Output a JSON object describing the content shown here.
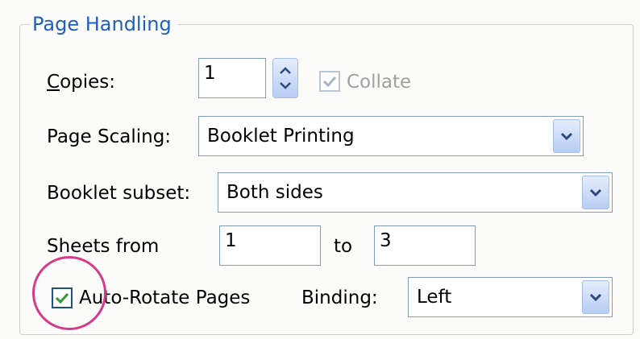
{
  "group": {
    "title": "Page Handling"
  },
  "copies": {
    "label_mnemonic": "C",
    "label_rest": "opies:",
    "value": "1"
  },
  "collate": {
    "label": "Collate",
    "checked": true,
    "enabled": false
  },
  "page_scaling": {
    "label": "Page Scaling:",
    "value": "Booklet Printing"
  },
  "booklet_subset": {
    "label": "Booklet subset:",
    "value": "Both sides"
  },
  "sheets": {
    "from_label": "Sheets from",
    "from_value": "1",
    "to_label": "to",
    "to_value": "3"
  },
  "auto_rotate": {
    "label": "Auto-Rotate Pages",
    "checked": true
  },
  "binding": {
    "label": "Binding:",
    "value": "Left"
  },
  "colors": {
    "title": "#1f5fbf",
    "highlight_circle": "#d63a8a",
    "checkmark": "#2f9a2f"
  }
}
